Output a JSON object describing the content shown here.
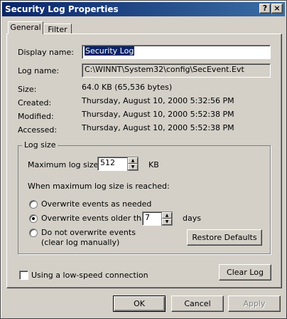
{
  "window": {
    "title": "Security Log Properties",
    "help_label": "?",
    "close_label": "×"
  },
  "tabs": [
    {
      "label": "General",
      "selected": true
    },
    {
      "label": "Filter",
      "selected": false
    }
  ],
  "general": {
    "display_name_label": "Display name:",
    "display_name_value": "Security Log",
    "log_name_label": "Log name:",
    "log_name_value": "C:\\WINNT\\System32\\config\\SecEvent.Evt",
    "size_label": "Size:",
    "size_value": "64.0 KB (65,536 bytes)",
    "created_label": "Created:",
    "created_value": "Thursday, August 10, 2000 5:32:56 PM",
    "modified_label": "Modified:",
    "modified_value": "Thursday, August 10, 2000 5:52:38 PM",
    "accessed_label": "Accessed:",
    "accessed_value": "Thursday, August 10, 2000 5:52:38 PM"
  },
  "log_size": {
    "group_label": "Log size",
    "max_size_label": "Maximum log size:",
    "max_size_value": "512",
    "max_size_unit": "KB",
    "when_reached_label": "When maximum log size is reached:",
    "options": [
      {
        "label": "Overwrite events as needed",
        "selected": false
      },
      {
        "label": "Overwrite events older than",
        "selected": true
      },
      {
        "label": "Do not overwrite events",
        "selected": false
      }
    ],
    "older_than_value": "7",
    "older_than_unit": "days",
    "do_not_overwrite_note": "(clear log manually)",
    "restore_defaults_label": "Restore Defaults"
  },
  "low_speed_label": "Using a low-speed connection",
  "low_speed_checked": false,
  "clear_log_label": "Clear Log",
  "footer": {
    "ok_label": "OK",
    "cancel_label": "Cancel",
    "apply_label": "Apply"
  }
}
